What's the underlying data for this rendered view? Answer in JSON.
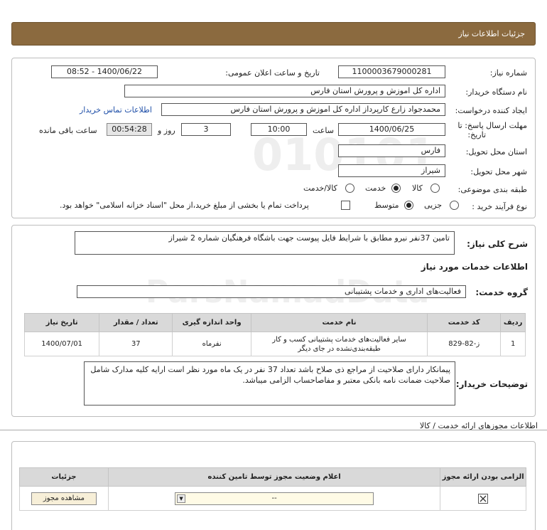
{
  "page": {
    "title": "جزئیات اطلاعات نیاز"
  },
  "info": {
    "need_number_label": "شماره نیاز:",
    "need_number": "1100003679000281",
    "announce_label": "تاریخ و ساعت اعلان عمومی:",
    "announce_value": "1400/06/22 - 08:52",
    "buyer_org_label": "نام دستگاه خریدار:",
    "buyer_org": "اداره کل اموزش و پرورش استان فارس",
    "requester_label": "ایجاد کننده درخواست:",
    "requester": "محمدجواد زارع کارپرداز اداره کل اموزش و پرورش استان فارس",
    "contact_link": "اطلاعات تماس خریدار",
    "deadline_label_1": "مهلت ارسال پاسخ: تا",
    "deadline_label_2": "تاریخ:",
    "deadline_date": "1400/06/25",
    "time_label": "ساعت",
    "deadline_time": "10:00",
    "days_value": "3",
    "days_label": "روز و",
    "remaining_time": "00:54:28",
    "remaining_label": "ساعت باقی مانده",
    "province_label": "استان محل تحویل:",
    "province": "فارس",
    "city_label": "شهر محل تحویل:",
    "city": "شیراز",
    "category_label": "طبقه بندی موضوعی:",
    "category_options": [
      "کالا",
      "خدمت",
      "کالا/خدمت"
    ],
    "category_selected": "خدمت",
    "process_label": "نوع فرآیند خرید :",
    "process_options": [
      "جزیی",
      "متوسط"
    ],
    "process_selected": "متوسط",
    "payment_text": "پرداخت تمام یا بخشی از مبلغ خرید،از محل \"اسناد خزانه اسلامی\" خواهد بود."
  },
  "description": {
    "label": "شرح کلی نیاز:",
    "text": "تامین 37نفر نیرو مطابق با شرایط فایل پیوست جهت باشگاه فرهنگیان شماره 2 شیراز"
  },
  "services": {
    "section_title": "اطلاعات خدمات مورد نیاز",
    "group_label": "گروه خدمت:",
    "group_value": "فعالیت‌های اداری و خدمات پشتیبانی",
    "table": {
      "headers": [
        "ردیف",
        "کد خدمت",
        "نام خدمت",
        "واحد اندازه گیری",
        "تعداد / مقدار",
        "تاریخ نیاز"
      ],
      "rows": [
        {
          "row": "1",
          "code": "ز-82-829",
          "name_line1": "سایر فعالیت‌های خدمات پشتیبانی کسب و کار",
          "name_line2": "طبقه‌بندی‌نشده در جای دیگر",
          "unit": "نفرماه",
          "qty": "37",
          "date": "1400/07/01"
        }
      ]
    }
  },
  "buyer_notes": {
    "label": "توضیحات خریدار:",
    "text": "پیمانکار دارای صلاحیت از مراجع ذی صلاح باشد تعداد 37 نفر در یک ماه مورد نظر است ارایه کلیه مدارک شامل صلاحیت ضمانت نامه بانکی معتبر و مفاصاحساب الزامی میباشد."
  },
  "permits": {
    "section_title": "اطلاعات مجوزهای ارائه خدمت / کالا",
    "headers": [
      "الزامی بودن ارائه مجوز",
      "اعلام وضعیت مجوز توسط تامین کننده",
      "جزئیات"
    ],
    "select_value": "--",
    "view_button": "مشاهده مجوز"
  },
  "watermark": {
    "line1": "010101",
    "line2": "ParsNamadData"
  },
  "colors": {
    "header_bg": "#8b6a3f",
    "link": "#1f4fa8",
    "table_header": "#d9d9d9"
  }
}
